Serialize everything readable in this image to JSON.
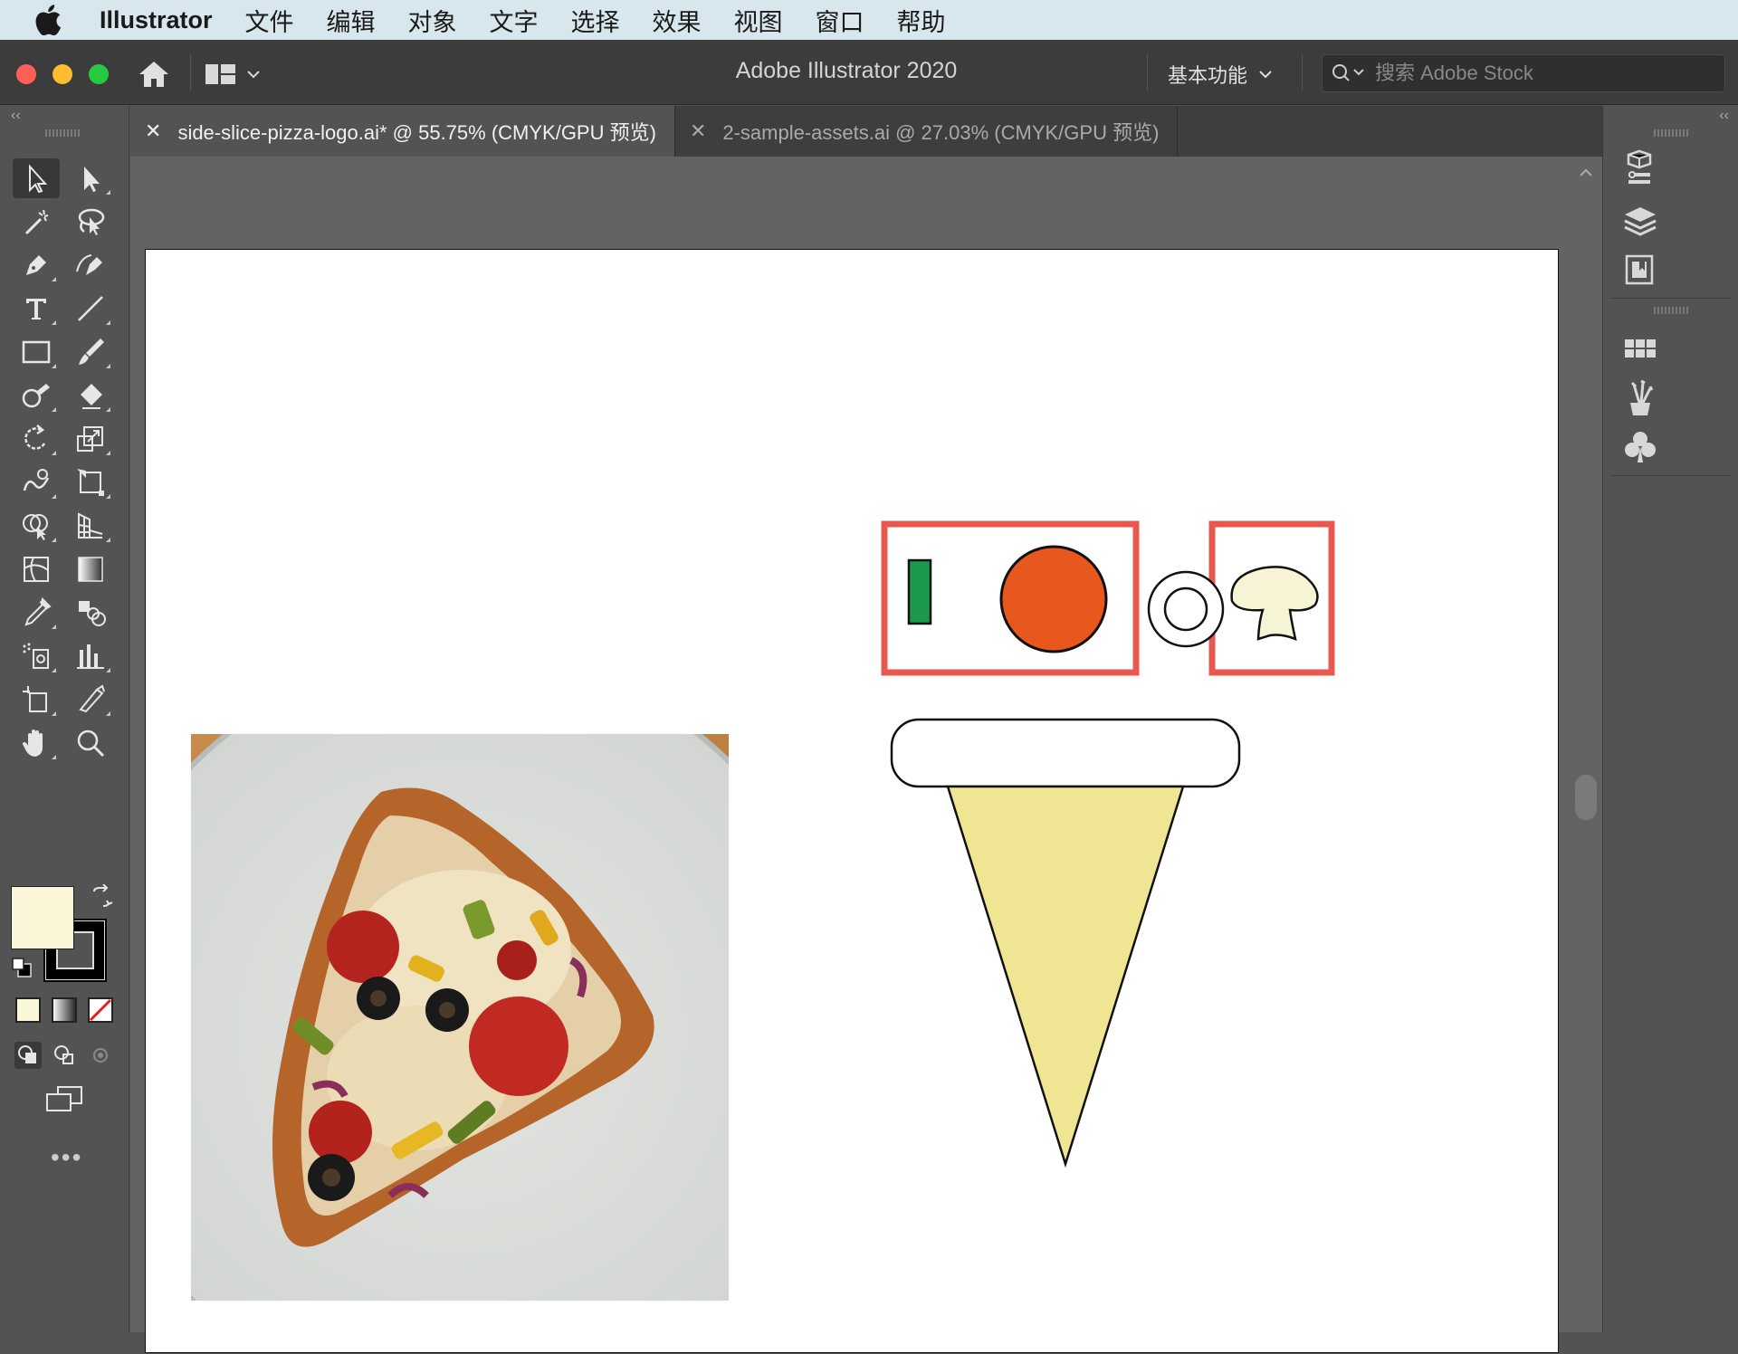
{
  "menubar": {
    "app_name": "Illustrator",
    "items": [
      "文件",
      "编辑",
      "对象",
      "文字",
      "选择",
      "效果",
      "视图",
      "窗口",
      "帮助"
    ]
  },
  "titlebar": {
    "title": "Adobe Illustrator 2020",
    "workspace": "基本功能",
    "search_placeholder": "搜索 Adobe Stock"
  },
  "tabs": [
    {
      "label": "side-slice-pizza-logo.ai* @ 55.75% (CMYK/GPU 预览)",
      "active": true
    },
    {
      "label": "2-sample-assets.ai @ 27.03% (CMYK/GPU 预览)",
      "active": false
    }
  ],
  "toolbar": {
    "fill_color": "#faf7d9",
    "stroke_color": "#000000",
    "more": "•••"
  },
  "artwork": {
    "pepper_color": "#1a9a4a",
    "pepperoni_color": "#e8571e",
    "crust_fill": "#ffffff",
    "slice_fill": "#f0e592",
    "mushroom_fill": "#f7f4d6",
    "highlight_color": "#e8584f"
  },
  "colors": {
    "accent_close": "#fe5f57",
    "accent_min": "#febc2e",
    "accent_max": "#28c840"
  }
}
